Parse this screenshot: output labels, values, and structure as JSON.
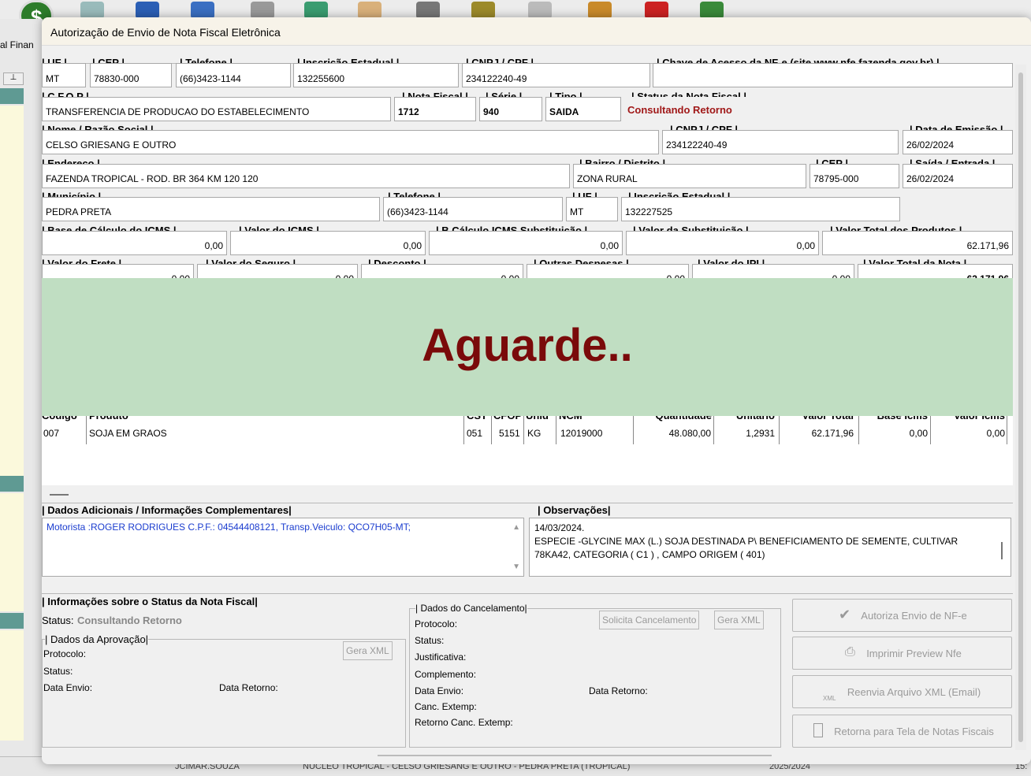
{
  "background": {
    "menu_partial": "al  Finan",
    "status_bar": [
      "JCIMAR.SOUZA",
      "NUCLEO TROPICAL - CELSO GRIESANG E OUTRO - PEDRA PRETA (TROPICAL)",
      "2025/2024",
      "15:"
    ],
    "header_row_partial": "CELSO GRIESANG E OUTRO"
  },
  "dialog": {
    "title": "Autorização de Envio de Nota Fiscal Eletrônica"
  },
  "emitente": {
    "uf_label": "| UF |",
    "uf": "MT",
    "cep_label": "| CEP |",
    "cep": "78830-000",
    "telefone_label": "| Telefone |",
    "telefone": "(66)3423-1144",
    "ie_label": "| Inscrição Estadual |",
    "ie": "132255600",
    "cnpj_label": "| CNPJ / CPF |",
    "cnpj": "234122240-49",
    "chave_label": "| Chave de Acesso da NF-e (site www.nfe.fazenda.gov.br) |",
    "chave": ""
  },
  "nota": {
    "cfop_label": "| C.F.O.P |",
    "cfop": "TRANSFERENCIA DE PRODUCAO DO ESTABELECIMENTO",
    "numero_label": "| Nota Fiscal |",
    "numero": "1712",
    "serie_label": "| Série |",
    "serie": "940",
    "tipo_label": "| Tipo |",
    "tipo": "SAIDA",
    "status_label": "| Status da Nota Fiscal |",
    "status": "Consultando Retorno"
  },
  "destinatario": {
    "nome_label": "| Nome  / Razão Social |",
    "nome": "CELSO GRIESANG E OUTRO",
    "cnpj_label": "| CNPJ / CPF |",
    "cnpj": "234122240-49",
    "emissao_label": "| Data de Emissão |",
    "emissao": "26/02/2024",
    "endereco_label": "| Endereço |",
    "endereco": "FAZENDA TROPICAL - ROD. BR 364 KM 120  120",
    "bairro_label": "| Bairro / Distrito |",
    "bairro": "ZONA RURAL",
    "cep_label": "| CEP |",
    "cep": "78795-000",
    "saida_label": "| Saída / Entrada |",
    "saida": "26/02/2024",
    "municipio_label": "| Município |",
    "municipio": "PEDRA PRETA",
    "telefone_label": "| Telefone |",
    "telefone": "(66)3423-1144",
    "uf_label": "| UF |",
    "uf": "MT",
    "ie_label": "| Inscrição Estadual |",
    "ie": "132227525"
  },
  "impostos": {
    "bc_icms_label": "| Base de Cálculo do ICMS |",
    "bc_icms": "0,00",
    "icms_label": "| Valor do ICMS |",
    "icms": "0,00",
    "bc_st_label": "| B.Cálculo ICMS Substituição |",
    "bc_st": "0,00",
    "st_label": "| Valor da Substituição |",
    "st": "0,00",
    "produtos_label": "| Valor Total dos Produtos |",
    "produtos": "62.171,96",
    "frete_label": "| Valor do Frete |",
    "frete": "0,00",
    "seguro_label": "| Valor do Seguro |",
    "seguro": "0,00",
    "desconto_label": "| Desconto |",
    "desconto": "0,00",
    "outras_label": "| Outras Despesas |",
    "outras": "0,00",
    "ipi_label": "| Valor do IPI |",
    "ipi": "0,00",
    "total_label": "| Valor Total da Nota |",
    "total": "62.171,96"
  },
  "overlay": {
    "text": "Aguarde.."
  },
  "itens": {
    "headers": [
      "Código",
      "Produto",
      "CST",
      "CFOP",
      "Unid",
      "NCM",
      "Quantidade",
      "Unitário",
      "Valor Total",
      "Base Icms",
      "Valor Icms"
    ],
    "rows": [
      [
        "007",
        "SOJA EM GRAOS",
        "051",
        "5151",
        "KG",
        "12019000",
        "48.080,00",
        "1,2931",
        "62.171,96",
        "0,00",
        "0,00"
      ]
    ]
  },
  "adicionais": {
    "dados_label": "| Dados Adicionais / Informações Complementares|",
    "dados": "Motorista :ROGER RODRIGUES C.P.F.: 04544408121, Transp.Veiculo: QCO7H05-MT;",
    "obs_label": "| Observações|",
    "obs_line1": "14/03/2024.",
    "obs_line2": "ESPECIE -GLYCINE MAX (L.) SOJA DESTINADA P\\ BENEFICIAMENTO DE SEMENTE, CULTIVAR",
    "obs_line3": "78KA42, CATEGORIA ( C1 ) , CAMPO ORIGEM ( 401)"
  },
  "status_info": {
    "section_label": "| Informações sobre o Status da Nota Fiscal|",
    "status_prefix": "Status:",
    "status_value": "Consultando Retorno",
    "aprovacao_label": "| Dados da Aprovação|",
    "protocolo": "Protocolo:",
    "status": "Status:",
    "data_envio": "Data Envio:",
    "data_retorno": "Data Retorno:",
    "gera_xml": "Gera XML"
  },
  "cancelamento": {
    "label": "| Dados do Cancelamento|",
    "protocolo": "Protocolo:",
    "status": "Status:",
    "justificativa": "Justificativa:",
    "complemento": "Complemento:",
    "data_envio": "Data Envio:",
    "data_retorno": "Data Retorno:",
    "canc_extemp": "Canc. Extemp:",
    "retorno_canc": "Retorno Canc. Extemp:",
    "solicita": "Solicita Cancelamento",
    "gera_xml": "Gera XML"
  },
  "actions": {
    "autoriza": "Autoriza Envio de NF-e",
    "imprimir": "Imprimir Preview Nfe",
    "reenvia": "Reenvia Arquivo XML (Email)",
    "xml_tag": "XML",
    "retorna": "Retorna para Tela de Notas Fiscais"
  },
  "colors": {
    "overlay": "#c0dec2",
    "overlay_text": "#7a0a0a",
    "status_red": "#a01818",
    "link_blue": "#1a3ccf"
  }
}
